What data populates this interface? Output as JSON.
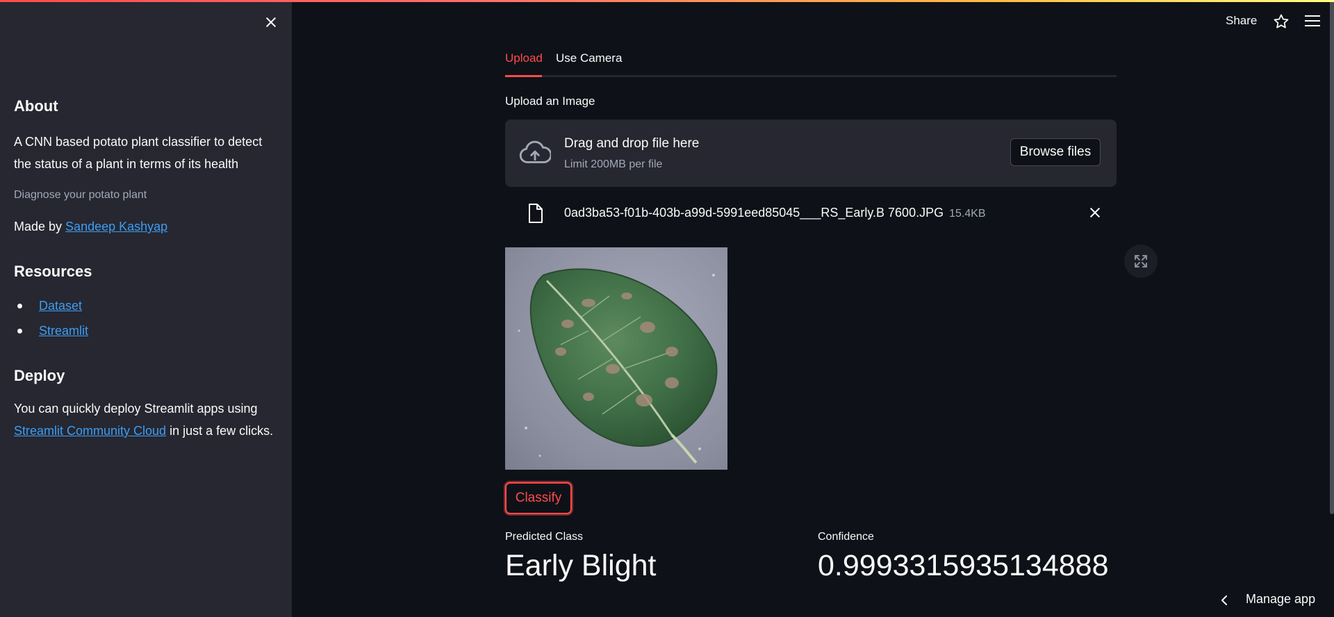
{
  "sidebar": {
    "about": {
      "heading": "About",
      "description": "A CNN based potato plant classifier to detect the status of a plant in terms of its health",
      "caption": "Diagnose your potato plant",
      "made_by_prefix": "Made by ",
      "author": "Sandeep Kashyap"
    },
    "resources": {
      "heading": "Resources",
      "items": [
        {
          "label": "Dataset"
        },
        {
          "label": "Streamlit"
        }
      ]
    },
    "deploy": {
      "heading": "Deploy",
      "text_prefix": "You can quickly deploy Streamlit apps using ",
      "link": "Streamlit Community Cloud",
      "text_suffix": " in just a few clicks."
    }
  },
  "header": {
    "share_label": "Share",
    "icons": [
      "star-icon",
      "hamburger-menu-icon"
    ]
  },
  "tabs": [
    {
      "label": "Upload",
      "active": true
    },
    {
      "label": "Use Camera",
      "active": false
    }
  ],
  "uploader": {
    "label": "Upload an Image",
    "drop_title": "Drag and drop file here",
    "limit_text": "Limit 200MB per file",
    "browse_label": "Browse files",
    "file": {
      "name": "0ad3ba53-f01b-403b-a99d-5991eed85045___RS_Early.B 7600.JPG",
      "size": "15.4KB"
    }
  },
  "classify_label": "Classify",
  "results": {
    "predicted_label": "Predicted Class",
    "predicted_value": "Early Blight",
    "confidence_label": "Confidence",
    "confidence_value": "0.9993315935134888"
  },
  "footer": {
    "manage_app_label": "Manage app"
  },
  "colors": {
    "background": "#0e1117",
    "sidebar": "#262730",
    "accent": "#ff4b4b",
    "link": "#3d9df3",
    "muted": "#a3a8b8"
  }
}
